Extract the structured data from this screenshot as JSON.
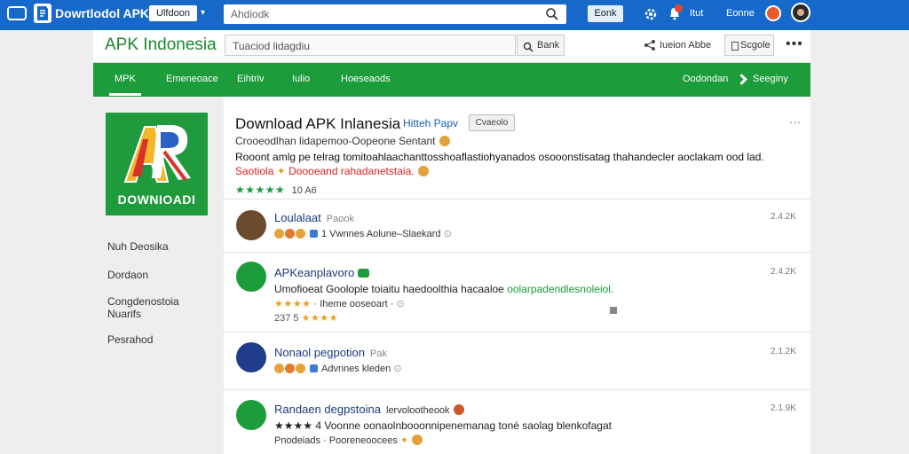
{
  "topbar": {
    "title": "Dowrtlodol APK",
    "pill": "Ulfdoon",
    "search_text": "Ahdiodk",
    "button": "Eonk",
    "text_1": "Itut",
    "text_2": "Eonne"
  },
  "header": {
    "brand": "APK Indonesia",
    "search_text": "Tuaciod lidagdiu",
    "search_button": "Bank",
    "right_text": "Iueion Abbe",
    "right_button": "Scgole",
    "more": "•••"
  },
  "nav": {
    "items": [
      "MPK",
      "Emeneoace",
      "Eihtriv",
      "Iulio",
      "Hoeseaods"
    ],
    "right_label": "Oodondan",
    "right_label_2": "Seeginy"
  },
  "app_icon": {
    "caption": "DOWNIOADI",
    "colors": {
      "bg": "#1f9a3d",
      "red": "#d8322a",
      "blue": "#2b61c4",
      "yellow": "#f2b62a",
      "white": "#ffffff"
    }
  },
  "sidebar": {
    "links": [
      "Nuh Deosika",
      "Dordaon",
      "Congdenostoia\nNuarifs",
      "Pesrahod"
    ]
  },
  "app": {
    "title": "Download APK Inlanesia",
    "subtitle": "Hitteh Papv",
    "tag": "Cvaeolo",
    "more": "···",
    "line_1": "Crooeodlhan lidapemoo-Oopeone Sentant",
    "line_2": "Rooont amlg pe telrag tomitoahlaachanttosshoaflastiohyanados osooonstisatag thahandecler aoclakam ood lad.",
    "line_3_red": "Saotiola",
    "line_3_rest": "Doooeand rahadanetstaia.",
    "stars": "★★★★★",
    "rating": "10 A6"
  },
  "feed": [
    {
      "name": "Loulalaat",
      "tag": "Paook",
      "text": "",
      "meta_text": "1 Vwnnes Aolune–Slaekard",
      "time": "2.4.2K",
      "avatar_color": "#6b4a2e"
    },
    {
      "name": "APKeanplavoro",
      "tag": "",
      "text_start": "Umofioeat Goolople toiaitu haedoolthia hacaaloe",
      "text_green": "oolarpadendlesnoleiol.",
      "meta_stars": "★★★★",
      "meta_num": "237 5",
      "meta_text": "· Iheme ooseoart ·",
      "time": "2.4.2K",
      "avatar_color": "#1d9c3b"
    },
    {
      "name": "Nonaol pegpotion",
      "tag": "Pak",
      "text": "",
      "meta_text": "Advnnes kleden",
      "time": "2.1.2K",
      "avatar_color": "#1f3d8a"
    },
    {
      "name": "Randaen degpstoina",
      "tag": "lervolootheook",
      "text": "★★★★ 4 Voonne oonaolnbooonnipenemanag toné saolag blenkofagat",
      "meta_text": "Pnodeiads · Pooreneoocees",
      "time": "2.1.9K",
      "avatar_color": "#1d9c3b"
    }
  ]
}
